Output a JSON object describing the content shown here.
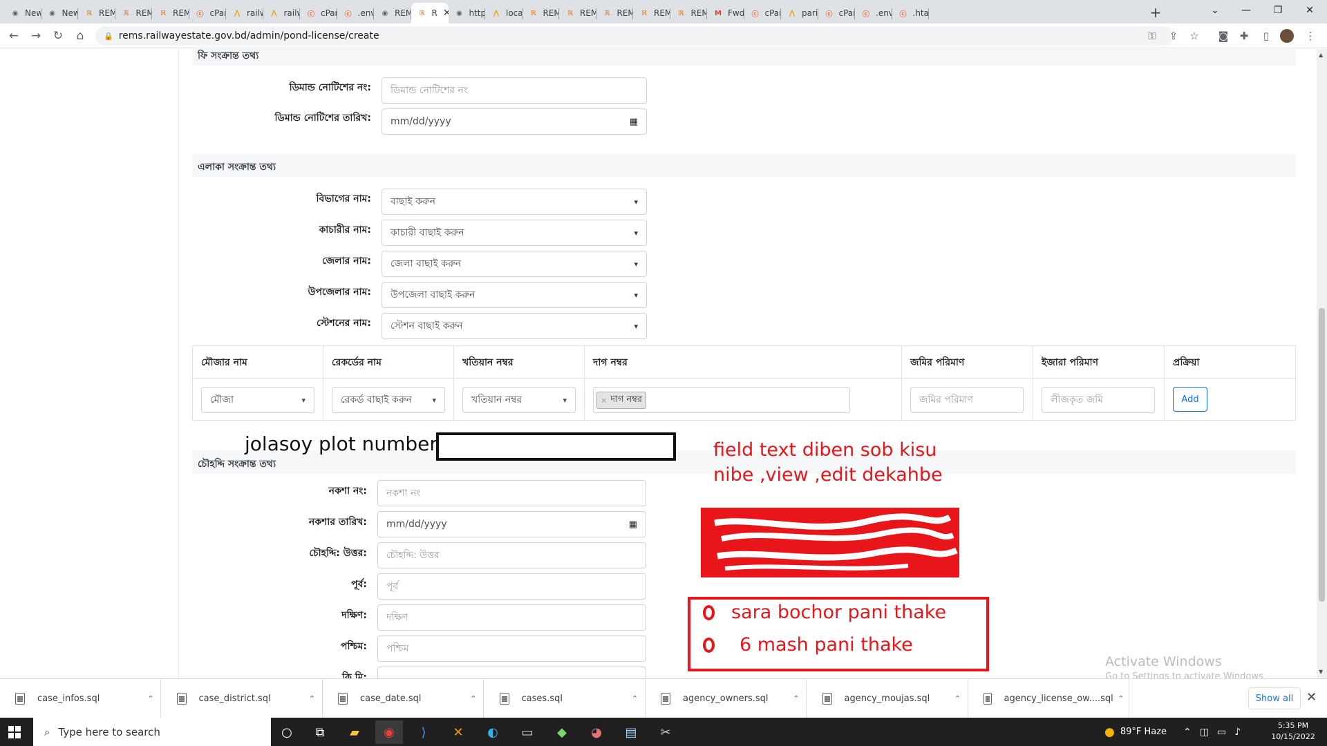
{
  "browser": {
    "tabs": [
      {
        "label": "New",
        "icon": "chrome-icon"
      },
      {
        "label": "New",
        "icon": "chrome-icon"
      },
      {
        "label": "REM",
        "icon": "rems-icon"
      },
      {
        "label": "REM",
        "icon": "rems-icon"
      },
      {
        "label": "REM",
        "icon": "rems-icon"
      },
      {
        "label": "cPan",
        "icon": "cpanel-icon"
      },
      {
        "label": "railw",
        "icon": "railway-icon"
      },
      {
        "label": "railw",
        "icon": "railway-icon"
      },
      {
        "label": "cPan",
        "icon": "cpanel-icon"
      },
      {
        "label": ".env",
        "icon": "cpanel-icon"
      },
      {
        "label": "REM",
        "icon": "chrome-icon"
      },
      {
        "label": "R",
        "icon": "rems-icon",
        "active": true
      },
      {
        "label": "http:",
        "icon": "chrome-icon"
      },
      {
        "label": "local",
        "icon": "railway-icon"
      },
      {
        "label": "REM",
        "icon": "rems-icon"
      },
      {
        "label": "REM",
        "icon": "rems-icon"
      },
      {
        "label": "REM",
        "icon": "rems-icon"
      },
      {
        "label": "REM",
        "icon": "rems-icon"
      },
      {
        "label": "REM",
        "icon": "rems-icon"
      },
      {
        "label": "Fwd:",
        "icon": "gmail-icon"
      },
      {
        "label": "cPan",
        "icon": "cpanel-icon"
      },
      {
        "label": "parit",
        "icon": "railway-icon"
      },
      {
        "label": "cPan",
        "icon": "cpanel-icon"
      },
      {
        "label": ".env",
        "icon": "cpanel-icon"
      },
      {
        "label": ".htac",
        "icon": "cpanel-icon"
      }
    ],
    "url": "rems.railwayestate.gov.bd/admin/pond-license/create"
  },
  "form": {
    "fee_section_title": "ফি সংক্রান্ত তথ্য",
    "demand_no_label": "ডিমান্ড নোটিশের নং:",
    "demand_no_placeholder": "ডিমান্ড নোটিশের নং",
    "demand_date_label": "ডিমান্ড নোটিশের তারিখ:",
    "demand_date_placeholder": "mm/dd/yyyy",
    "area_section_title": "এলাকা সংক্রান্ত তথ্য",
    "division_label": "বিভাগের নাম:",
    "division_value": "বাছাই করুন",
    "kachari_label": "কাচারীর নাম:",
    "kachari_value": "কাচারী বাছাই করুন",
    "district_label": "জেলার নাম:",
    "district_value": "জেলা বাছাই করুন",
    "upazila_label": "উপজেলার নাম:",
    "upazila_value": "উপজেলা বাছাই করুন",
    "station_label": "স্টেশনের নাম:",
    "station_value": "স্টেশন বাছাই করুন",
    "table": {
      "headers": [
        "মৌজার নাম",
        "রেকর্ডের নাম",
        "খতিয়ান নম্বর",
        "দাগ নম্বর",
        "জমির পরিমাণ",
        "ইজারা পরিমাণ",
        "প্রক্রিয়া"
      ],
      "mouza_value": "মৌজা",
      "record_value": "রেকর্ড বাছাই করুন",
      "khatian_value": "খতিয়ান নম্বর",
      "dag_tag": "দাগ নম্বর",
      "land_placeholder": "জমির পরিমাণ",
      "lease_placeholder": "লীজকৃত জমি",
      "add_label": "Add"
    },
    "boundary_section_title": "চৌহদ্দি সংক্রান্ত তথ্য",
    "map_no_label": "নকশা নং:",
    "map_no_placeholder": "নকশা নং",
    "map_date_label": "নকশার তারিখ:",
    "map_date_placeholder": "mm/dd/yyyy",
    "north_label": "চৌহদ্দি: উত্তর:",
    "north_placeholder": "চৌহদ্দি: উত্তর",
    "east_label": "পূর্ব:",
    "east_placeholder": "পূর্ব",
    "south_label": "দক্ষিণ:",
    "south_placeholder": "দক্ষিণ",
    "west_label": "পশ্চিম:",
    "west_placeholder": "পশ্চিম",
    "next_label": "কি মি:"
  },
  "annotations": {
    "plot_label": "jolasoy plot number :",
    "note_line1": "field text diben  sob kisu",
    "note_line2": "nibe ,view ,edit  dekahbe",
    "options": [
      "sara bochor pani thake",
      "6 mash pani thake"
    ],
    "accent_color": "#e8161b"
  },
  "watermark": {
    "title": "Activate Windows",
    "subtitle": "Go to Settings to activate Windows."
  },
  "downloads": {
    "files": [
      "case_infos.sql",
      "case_district.sql",
      "case_date.sql",
      "cases.sql",
      "agency_owners.sql",
      "agency_moujas.sql",
      "agency_license_ow....sql"
    ],
    "show_all": "Show all"
  },
  "taskbar": {
    "search_placeholder": "Type here to search",
    "weather": "89°F  Haze",
    "time": "5:35 PM",
    "date": "10/15/2022"
  }
}
